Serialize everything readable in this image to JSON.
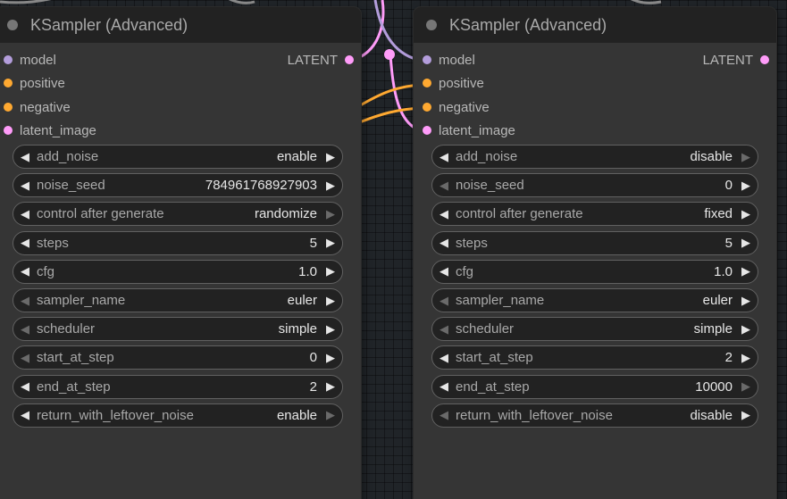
{
  "colors": {
    "canvas": "#202428",
    "node_body": "#353535",
    "node_header": "#222222",
    "model": "#b39ddb",
    "conditioning": "#ffa931",
    "latent": "#ff9cf9"
  },
  "left_node": {
    "title": "KSampler (Advanced)",
    "inputs": [
      "model",
      "positive",
      "negative",
      "latent_image"
    ],
    "output": "LATENT",
    "widgets": [
      {
        "label": "add_noise",
        "value": "enable",
        "left": true,
        "right": true
      },
      {
        "label": "noise_seed",
        "value": "784961768927903",
        "left": true,
        "right": true
      },
      {
        "label": "control after generate",
        "value": "randomize",
        "left": true,
        "right": false
      },
      {
        "label": "steps",
        "value": "5",
        "left": true,
        "right": true
      },
      {
        "label": "cfg",
        "value": "1.0",
        "left": true,
        "right": true
      },
      {
        "label": "sampler_name",
        "value": "euler",
        "left": false,
        "right": true
      },
      {
        "label": "scheduler",
        "value": "simple",
        "left": false,
        "right": true
      },
      {
        "label": "start_at_step",
        "value": "0",
        "left": false,
        "right": true
      },
      {
        "label": "end_at_step",
        "value": "2",
        "left": true,
        "right": true
      },
      {
        "label": "return_with_leftover_noise",
        "value": "enable",
        "left": true,
        "right": false
      }
    ]
  },
  "right_node": {
    "title": "KSampler (Advanced)",
    "inputs": [
      "model",
      "positive",
      "negative",
      "latent_image"
    ],
    "output": "LATENT",
    "widgets": [
      {
        "label": "add_noise",
        "value": "disable",
        "left": true,
        "right": false
      },
      {
        "label": "noise_seed",
        "value": "0",
        "left": false,
        "right": true
      },
      {
        "label": "control after generate",
        "value": "fixed",
        "left": true,
        "right": true
      },
      {
        "label": "steps",
        "value": "5",
        "left": true,
        "right": true
      },
      {
        "label": "cfg",
        "value": "1.0",
        "left": true,
        "right": true
      },
      {
        "label": "sampler_name",
        "value": "euler",
        "left": false,
        "right": true
      },
      {
        "label": "scheduler",
        "value": "simple",
        "left": false,
        "right": true
      },
      {
        "label": "start_at_step",
        "value": "2",
        "left": true,
        "right": true
      },
      {
        "label": "end_at_step",
        "value": "10000",
        "left": true,
        "right": false
      },
      {
        "label": "return_with_leftover_noise",
        "value": "disable",
        "left": false,
        "right": true
      }
    ]
  }
}
